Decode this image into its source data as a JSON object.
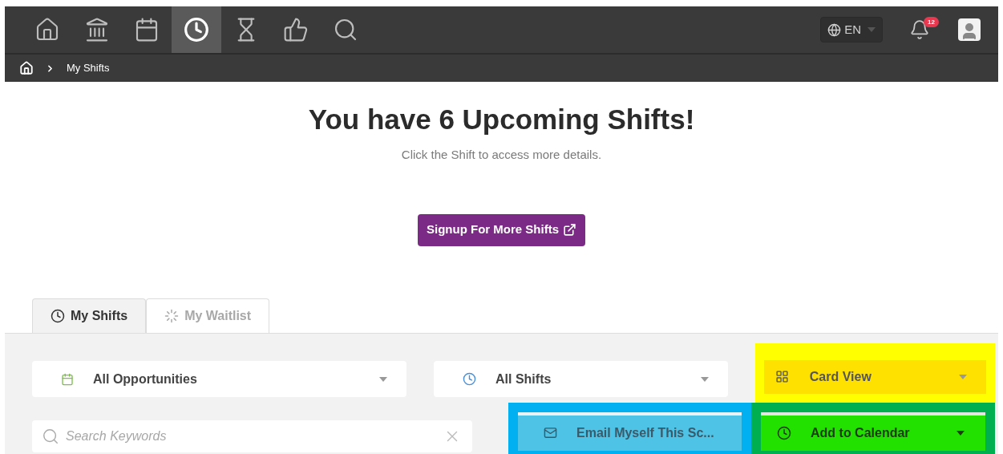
{
  "nav_items": [
    {
      "kind": "home",
      "selected": false
    },
    {
      "kind": "bank",
      "selected": false
    },
    {
      "kind": "calendar",
      "selected": false
    },
    {
      "kind": "clock",
      "selected": true
    },
    {
      "kind": "hourglass",
      "selected": false
    },
    {
      "kind": "thumbs",
      "selected": false
    },
    {
      "kind": "search",
      "selected": false
    }
  ],
  "language": "EN",
  "notification_count": "12",
  "breadcrumb": [
    "My Shifts"
  ],
  "heading": "You have 6 Upcoming Shifts!",
  "subtitle": "Click the Shift to access more details.",
  "signup_button": "Signup For More Shifts",
  "tabs": [
    {
      "label": "My Shifts",
      "kind": "clock",
      "selected": true
    },
    {
      "label": "My Waitlist",
      "kind": "spinner",
      "selected": false
    }
  ],
  "filters": [
    {
      "label": "All Opportunities",
      "kind": "calendar"
    },
    {
      "label": "All Shifts",
      "kind": "clock"
    }
  ],
  "view_select": "Card View",
  "search": {
    "placeholder": "Search Keywords"
  },
  "email_button": "Email Myself This Sc...",
  "calendar_button": "Add to Calendar"
}
